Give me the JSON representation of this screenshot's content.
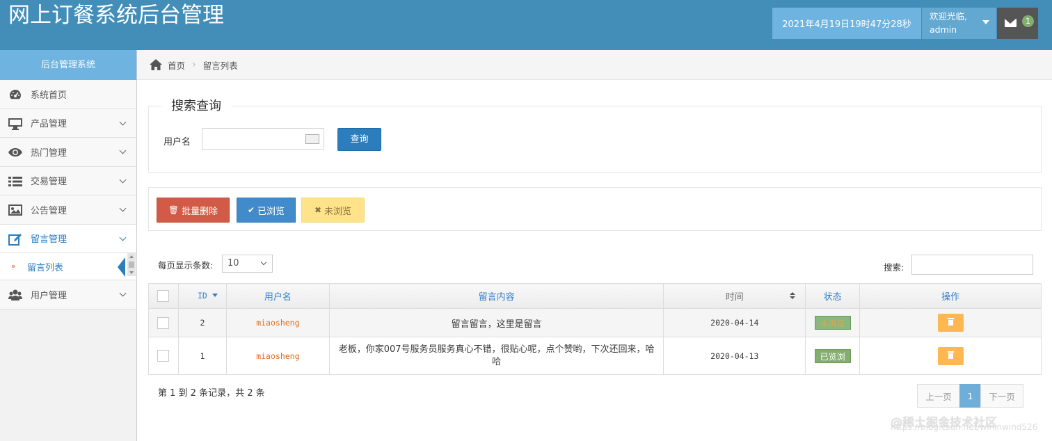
{
  "header": {
    "brand": "网上订餐系统后台管理",
    "datetime": "2021年4月19日19时47分28秒",
    "welcome": "欢迎光临,",
    "username": "admin",
    "message_count": "1"
  },
  "sidebar": {
    "title": "后台管理系统",
    "items": [
      {
        "label": "系统首页",
        "icon": "dashboard-icon"
      },
      {
        "label": "产品管理",
        "icon": "desktop-icon"
      },
      {
        "label": "热门管理",
        "icon": "eye-icon"
      },
      {
        "label": "交易管理",
        "icon": "list-icon"
      },
      {
        "label": "公告管理",
        "icon": "picture-icon"
      },
      {
        "label": "留言管理",
        "icon": "edit-icon"
      },
      {
        "label": "用户管理",
        "icon": "users-icon"
      }
    ],
    "sub_item": "留言列表"
  },
  "breadcrumb": {
    "home": "首页",
    "current": "留言列表"
  },
  "search": {
    "legend": "搜索查询",
    "user_label": "用户名",
    "button": "查询"
  },
  "actions": {
    "batch_delete": "批量删除",
    "mark_read": "已浏览",
    "mark_unread": "未浏览"
  },
  "table_controls": {
    "page_size_label": "每页显示条数:",
    "page_size": "10",
    "filter_label": "搜索:"
  },
  "table": {
    "columns": [
      "ID",
      "用户名",
      "留言内容",
      "时间",
      "状态",
      "操作"
    ],
    "rows": [
      {
        "id": "2",
        "user": "miaosheng",
        "content": "留言留言，这里是留言",
        "time": "2020-04-14",
        "status": "未浏览"
      },
      {
        "id": "1",
        "user": "miaosheng",
        "content": "老板，你家007号服务员服务真心不错，很贴心呢，点个赞哟，下次还回来，哈哈",
        "time": "2020-04-13",
        "status": "已览浏"
      }
    ]
  },
  "pagination": {
    "info": "第 1 到 2 条记录，共 2 条",
    "prev": "上一页",
    "current": "1",
    "next": "下一页"
  },
  "watermark": {
    "text": "@稀土掘金技术社区",
    "url": "https://blog.csdn.net/wininwind526"
  }
}
